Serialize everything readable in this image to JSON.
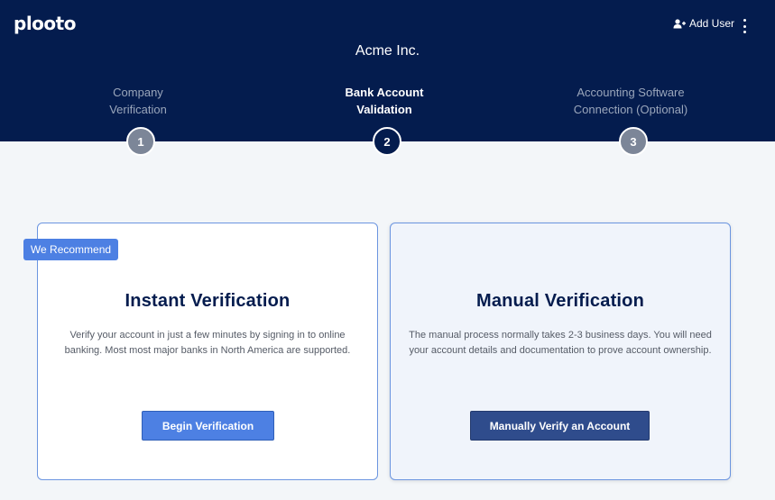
{
  "brand": {
    "logo_text": "plooto"
  },
  "header": {
    "add_user_label": "Add User",
    "add_user_icon": "add-user-icon",
    "menu_icon": "kebab-menu-icon",
    "company_name": "Acme Inc."
  },
  "steps": [
    {
      "number": "1",
      "label": "Company\nVerification",
      "state": "inactive"
    },
    {
      "number": "2",
      "label": "Bank Account\nValidation",
      "state": "active"
    },
    {
      "number": "3",
      "label": "Accounting Software\nConnection (Optional)",
      "state": "inactive"
    }
  ],
  "instant": {
    "badge": "We Recommend",
    "title": "Instant Verification",
    "description": "Verify your account in just a few minutes by signing in to online banking. Most most major banks in North America are supported.",
    "button_label": "Begin Verification"
  },
  "manual": {
    "title": "Manual Verification",
    "description": "The manual process normally takes 2-3 business days. You will need your account details and documentation to prove account ownership.",
    "button_label": "Manually Verify an Account"
  },
  "colors": {
    "header_bg": "#041c4e",
    "accent": "#4d80e3",
    "manual_button": "#2f4c8c",
    "page_bg": "#f3f6f9"
  }
}
